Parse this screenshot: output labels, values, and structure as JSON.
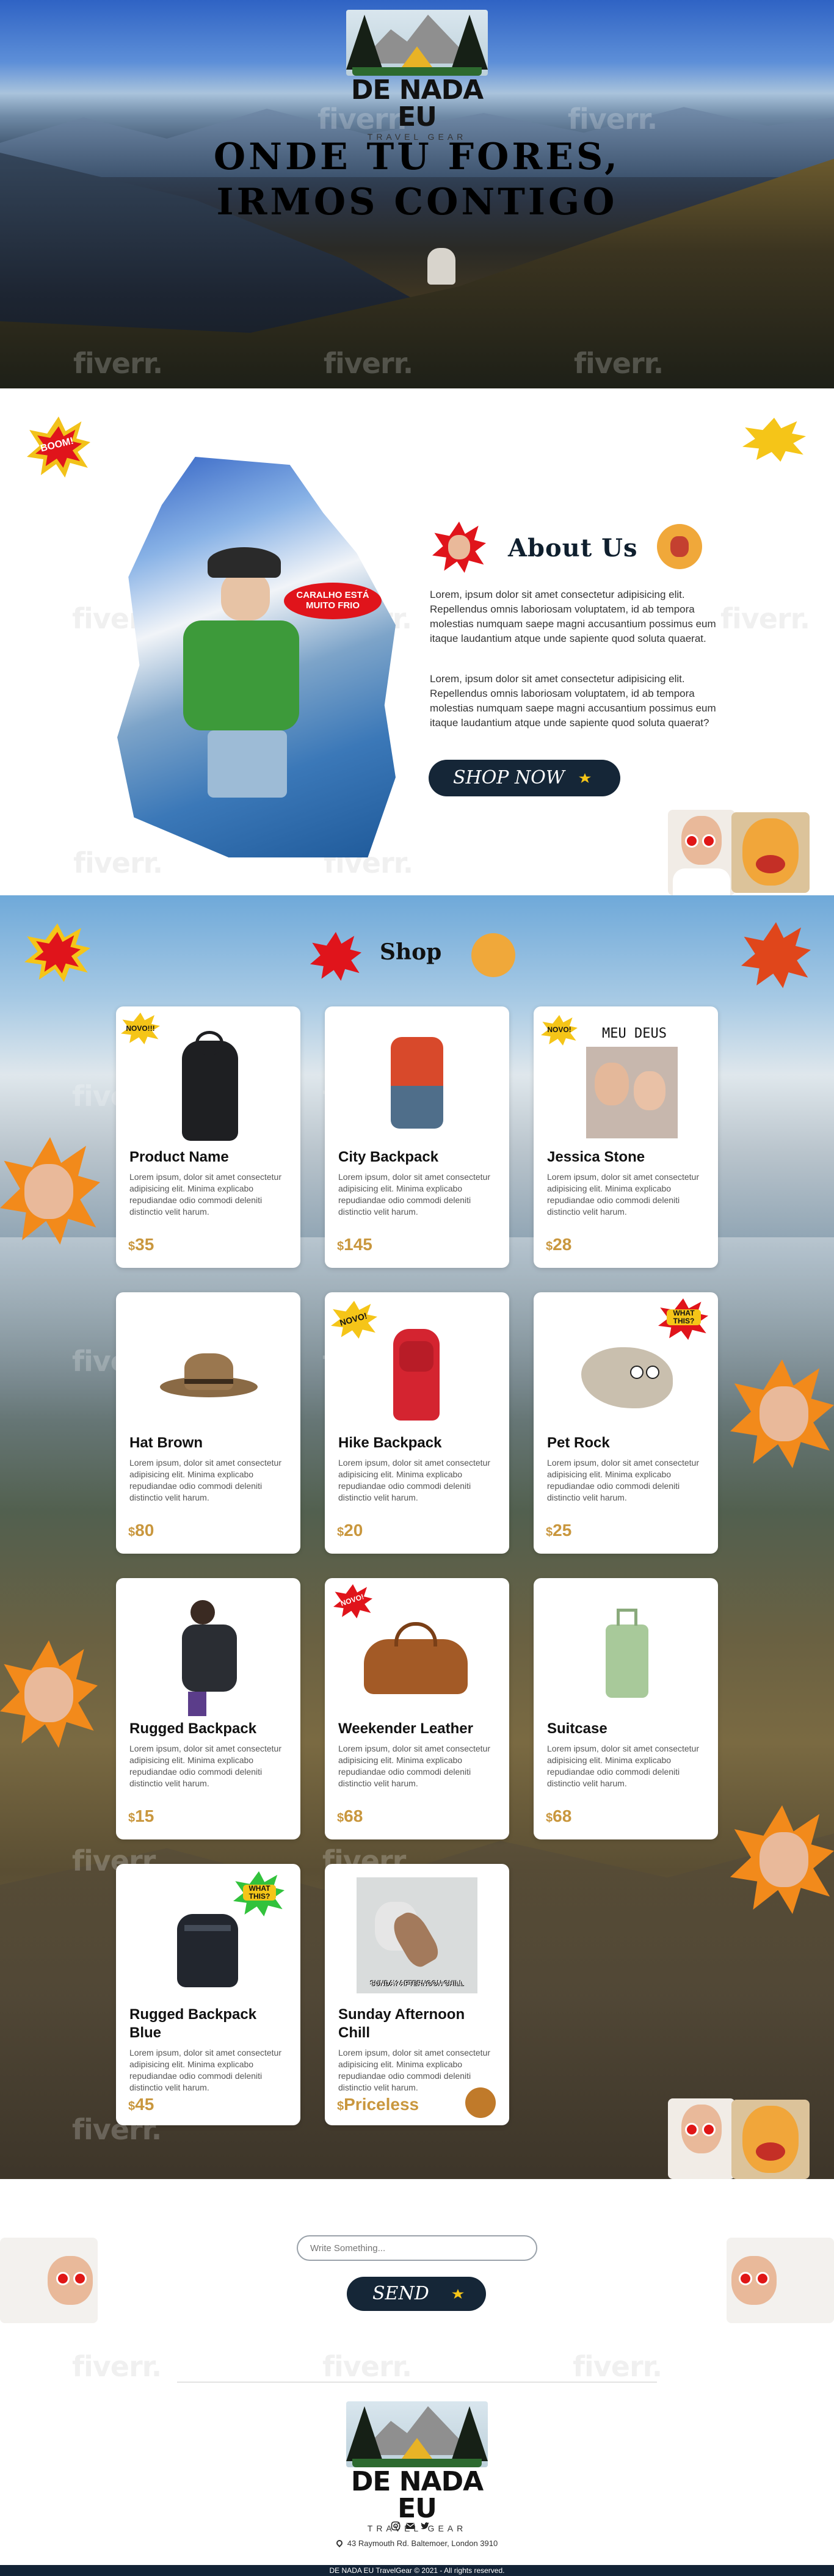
{
  "watermark": "fiverr.",
  "brand": {
    "name": "DE NADA EU",
    "tagline": "TRAVEL GEAR"
  },
  "hero": {
    "headline_line1": "ONDE TU FORES,",
    "headline_line2": "IRMOS CONTIGO"
  },
  "about": {
    "title": "About Us",
    "speech_bubble": "CARALHO ESTÁ MUITO FRIO",
    "sticker_boom": "BOOM!",
    "paragraph1": "Lorem, ipsum dolor sit amet consectetur adipisicing elit. Repellendus omnis laboriosam voluptatem, id ab tempora molestias numquam saepe magni accusantium possimus eum itaque laudantium atque unde sapiente quod soluta quaerat.",
    "paragraph2": "Lorem, ipsum dolor sit amet consectetur adipisicing elit. Repellendus omnis laboriosam voluptatem, id ab tempora molestias numquam saepe magni accusantium possimus eum itaque laudantium atque unde sapiente quod soluta quaerat?",
    "cta_label": "SHOP NOW"
  },
  "shop": {
    "title": "Shop",
    "products": [
      {
        "name": "Product Name",
        "desc": "Lorem ipsum, dolor sit amet consectetur adipisicing elit. Minima explicabo repudiandae odio commodi deleniti distinctio velit harum.",
        "currency": "$",
        "price": "35",
        "tag": "NOVO!!!"
      },
      {
        "name": "City Backpack",
        "desc": "Lorem ipsum, dolor sit amet consectetur adipisicing elit. Minima explicabo repudiandae odio commodi deleniti distinctio velit harum.",
        "currency": "$",
        "price": "145",
        "tag": ""
      },
      {
        "name": "Jessica Stone",
        "desc": "Lorem ipsum, dolor sit amet consectetur adipisicing elit. Minima explicabo repudiandae odio commodi deleniti distinctio velit harum.",
        "currency": "$",
        "price": "28",
        "tag": "NOVO!",
        "caption": "MEU DEUS"
      },
      {
        "name": "Hat Brown",
        "desc": "Lorem ipsum, dolor sit amet consectetur adipisicing elit. Minima explicabo repudiandae odio commodi deleniti distinctio velit harum.",
        "currency": "$",
        "price": "80",
        "tag": ""
      },
      {
        "name": "Hike Backpack",
        "desc": "Lorem ipsum, dolor sit amet consectetur adipisicing elit. Minima explicabo repudiandae odio commodi deleniti distinctio velit harum.",
        "currency": "$",
        "price": "20",
        "tag": "NOVO!"
      },
      {
        "name": "Pet Rock",
        "desc": "Lorem ipsum, dolor sit amet consectetur adipisicing elit. Minima explicabo repudiandae odio commodi deleniti distinctio velit harum.",
        "currency": "$",
        "price": "25",
        "tag": "WHAT THIS?"
      },
      {
        "name": "Rugged Backpack",
        "desc": "Lorem ipsum, dolor sit amet consectetur adipisicing elit. Minima explicabo repudiandae odio commodi deleniti distinctio velit harum.",
        "currency": "$",
        "price": "15",
        "tag": ""
      },
      {
        "name": "Weekender Leather",
        "desc": "Lorem ipsum, dolor sit amet consectetur adipisicing elit. Minima explicabo repudiandae odio commodi deleniti distinctio velit harum.",
        "currency": "$",
        "price": "68",
        "tag": "NOVO!"
      },
      {
        "name": "Suitcase",
        "desc": "Lorem ipsum, dolor sit amet consectetur adipisicing elit. Minima explicabo repudiandae odio commodi deleniti distinctio velit harum.",
        "currency": "$",
        "price": "68",
        "tag": ""
      },
      {
        "name": "Rugged Backpack Blue",
        "desc": "Lorem ipsum, dolor sit amet consectetur adipisicing elit. Minima explicabo repudiandae odio commodi deleniti distinctio velit harum.",
        "currency": "$",
        "price": "45",
        "tag": "WHAT THIS?"
      },
      {
        "name": "Sunday Afternoon Chill",
        "desc": "Lorem ipsum, dolor sit amet consectetur adipisicing elit. Minima explicabo repudiandae odio commodi deleniti distinctio velit harum.",
        "currency": "$",
        "price": "Priceless",
        "tag": "",
        "caption": "SUNDAY AFTERNOON CHILL"
      }
    ]
  },
  "contact": {
    "input_placeholder": "Write Something...",
    "send_label": "SEND"
  },
  "footer": {
    "address": "43 Raymouth Rd. Baltemoer, London 3910",
    "copyright": "DE NADA EU TravelGear © 2021 - All rights reserved."
  },
  "colors": {
    "navy": "#152637",
    "price_gold": "#c9973e",
    "sticker_red": "#e0141b",
    "sticker_yellow": "#f5c518"
  },
  "icons": [
    "instagram-icon",
    "mail-icon",
    "twitter-icon",
    "location-pin-icon",
    "star-icon"
  ]
}
